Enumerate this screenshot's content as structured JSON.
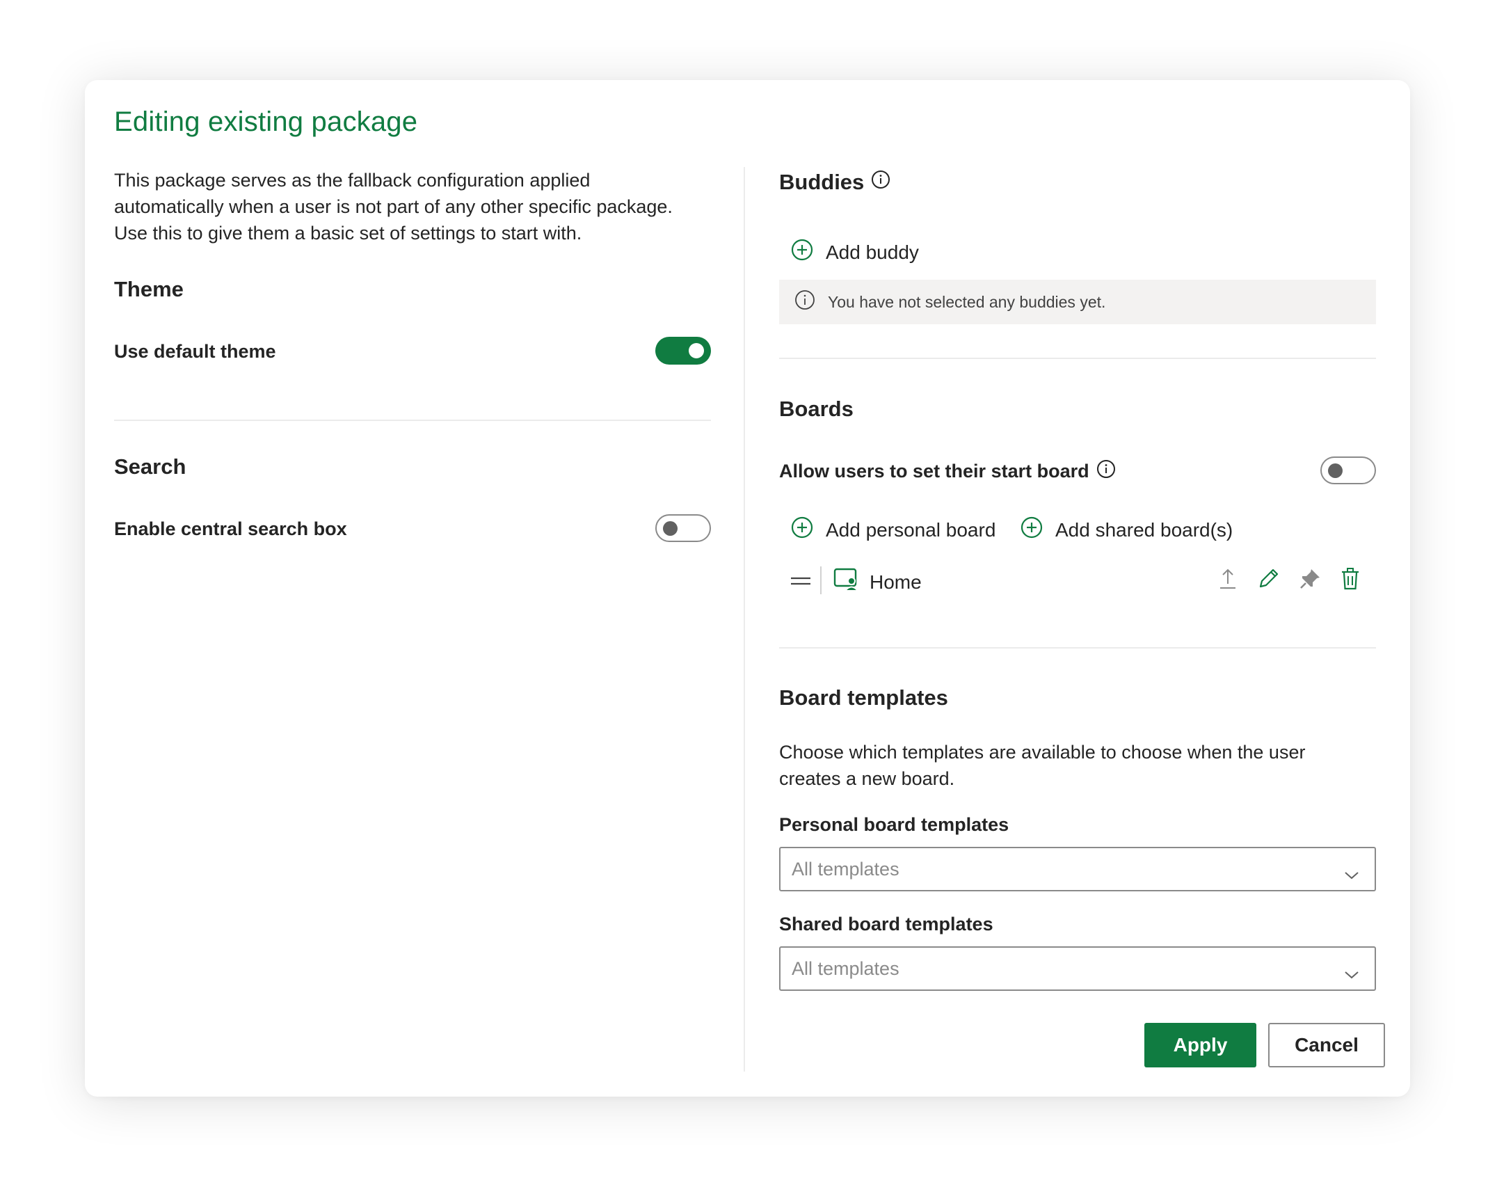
{
  "dialog": {
    "title": "Editing existing package",
    "intro_lines": [
      "This package serves as the fallback configuration applied",
      "automatically when a user is not part of any other specific package.",
      "Use this to give them a basic set of settings to start with."
    ]
  },
  "theme": {
    "section_title": "Theme",
    "toggle_label": "Use default theme",
    "toggle_on": true
  },
  "search": {
    "section_title": "Search",
    "toggle_label": "Enable central search box",
    "toggle_on": false
  },
  "buddies": {
    "section_title": "Buddies",
    "add_label": "Add buddy",
    "empty_notice": "You have not selected any buddies yet."
  },
  "boards": {
    "section_title": "Boards",
    "start_board_label": "Allow users to set their start board",
    "start_board_on": false,
    "add_personal_label": "Add personal board",
    "add_shared_label": "Add shared board(s)",
    "items": [
      {
        "name": "Home",
        "icon": "personal-board-icon"
      }
    ]
  },
  "templates": {
    "section_title": "Board templates",
    "description_lines": [
      "Choose which templates are available to choose when the user",
      "creates a new board."
    ],
    "personal_label": "Personal board templates",
    "personal_value": "All templates",
    "shared_label": "Shared board templates",
    "shared_value": "All templates"
  },
  "footer": {
    "apply_label": "Apply",
    "cancel_label": "Cancel"
  },
  "colors": {
    "accent": "#107c41",
    "notice_bg": "#f3f2f1",
    "border": "#8a8a8a"
  }
}
